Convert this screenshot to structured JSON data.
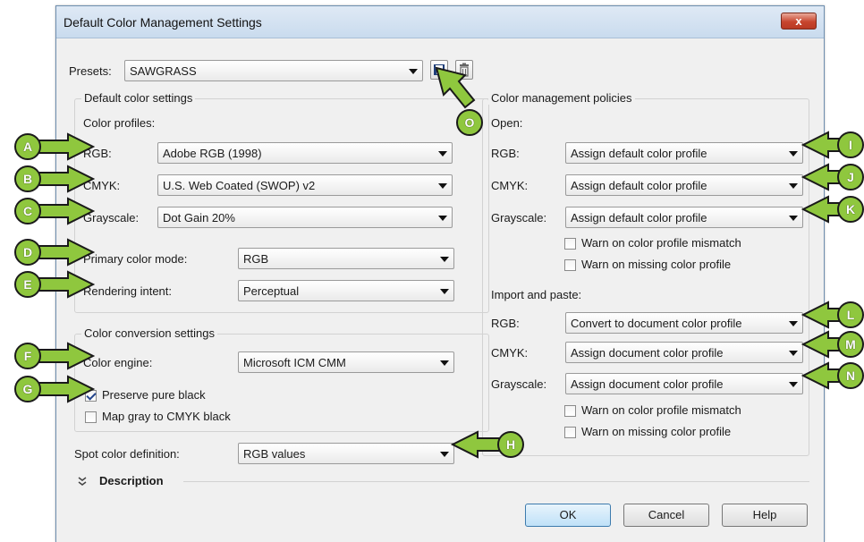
{
  "window": {
    "title": "Default Color Management Settings",
    "close_label": "x"
  },
  "presets": {
    "label": "Presets:",
    "value": "SAWGRASS",
    "save_icon": "save-icon",
    "delete_icon": "trash-icon"
  },
  "default_settings": {
    "group_title": "Default color settings",
    "profiles_title": "Color profiles:",
    "rgb_label": "RGB:",
    "rgb_value": "Adobe RGB (1998)",
    "cmyk_label": "CMYK:",
    "cmyk_value": "U.S. Web Coated (SWOP) v2",
    "gray_label": "Grayscale:",
    "gray_value": "Dot Gain 20%",
    "primary_label": "Primary color mode:",
    "primary_value": "RGB",
    "intent_label": "Rendering intent:",
    "intent_value": "Perceptual"
  },
  "conversion": {
    "group_title": "Color conversion settings",
    "engine_label": "Color engine:",
    "engine_value": "Microsoft ICM CMM",
    "preserve_label": "Preserve pure black",
    "preserve_checked": true,
    "mapgray_label": "Map gray to CMYK black",
    "mapgray_checked": false
  },
  "spot": {
    "label": "Spot color definition:",
    "value": "RGB values"
  },
  "policies": {
    "group_title": "Color management policies",
    "open_title": "Open:",
    "open_rgb_label": "RGB:",
    "open_rgb_value": "Assign default color profile",
    "open_cmyk_label": "CMYK:",
    "open_cmyk_value": "Assign default color profile",
    "open_gray_label": "Grayscale:",
    "open_gray_value": "Assign default color profile",
    "open_warn_mismatch": "Warn on color profile mismatch",
    "open_warn_missing": "Warn on missing color profile",
    "import_title": "Import and paste:",
    "imp_rgb_label": "RGB:",
    "imp_rgb_value": "Convert to document color profile",
    "imp_cmyk_label": "CMYK:",
    "imp_cmyk_value": "Assign document color profile",
    "imp_gray_label": "Grayscale:",
    "imp_gray_value": "Assign document color profile",
    "imp_warn_mismatch": "Warn on color profile mismatch",
    "imp_warn_missing": "Warn on missing color profile"
  },
  "description": {
    "label": "Description",
    "chevron_icon": "double-chevron-down-icon"
  },
  "buttons": {
    "ok": "OK",
    "cancel": "Cancel",
    "help": "Help"
  },
  "callouts": {
    "a": "A",
    "b": "B",
    "c": "C",
    "d": "D",
    "e": "E",
    "f": "F",
    "g": "G",
    "h": "H",
    "i": "I",
    "j": "J",
    "k": "K",
    "l": "L",
    "m": "M",
    "n": "N",
    "o": "O"
  },
  "colors": {
    "callout_green": "#8fc73e",
    "close_red": "#c7452e",
    "accent_blue": "#24458c"
  }
}
